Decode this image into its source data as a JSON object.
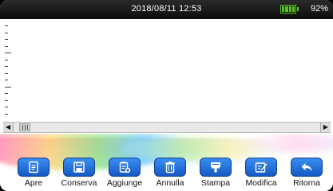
{
  "status": {
    "datetime": "2018/08/11  12:53",
    "battery_percent": "92%",
    "battery_level": 0.92,
    "battery_color": "#52c41a"
  },
  "toolbar": {
    "accent": "#1a6ed8",
    "buttons": [
      {
        "label": "Apre",
        "icon": "open-file-icon"
      },
      {
        "label": "Conserva",
        "icon": "save-icon"
      },
      {
        "label": "Aggiunge",
        "icon": "add-document-icon"
      },
      {
        "label": "Annulla",
        "icon": "trash-icon"
      },
      {
        "label": "Stampa",
        "icon": "print-icon"
      },
      {
        "label": "Modifica",
        "icon": "edit-icon"
      },
      {
        "label": "Ritorna",
        "icon": "back-arrow-icon"
      }
    ]
  },
  "scrollbar": {
    "left_arrow": "◀",
    "right_arrow": "▶"
  }
}
